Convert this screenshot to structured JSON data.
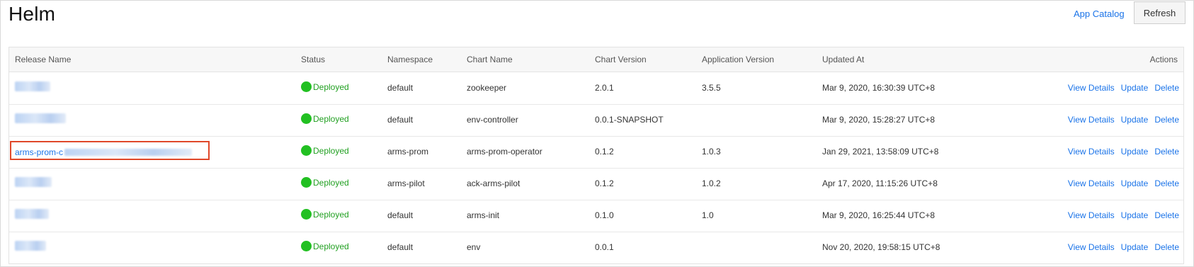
{
  "page": {
    "title": "Helm"
  },
  "toolbar": {
    "catalog_label": "App Catalog",
    "refresh_label": "Refresh"
  },
  "colors": {
    "link": "#1a73e8",
    "deployed": "#22c022",
    "highlight": "#e0482a"
  },
  "table": {
    "headers": {
      "release_name": "Release Name",
      "status": "Status",
      "namespace": "Namespace",
      "chart_name": "Chart Name",
      "chart_version": "Chart Version",
      "app_version": "Application Version",
      "updated_at": "Updated At",
      "actions": "Actions"
    },
    "action_labels": {
      "view": "View Details",
      "update": "Update",
      "delete": "Delete"
    },
    "rows": [
      {
        "name_visible": "",
        "status": "Deployed",
        "namespace": "default",
        "chart": "zookeeper",
        "chart_version": "2.0.1",
        "app_version": "3.5.5",
        "updated": "Mar 9, 2020, 16:30:39 UTC+8"
      },
      {
        "name_visible": "",
        "status": "Deployed",
        "namespace": "default",
        "chart": "env-controller",
        "chart_version": "0.0.1-SNAPSHOT",
        "app_version": "",
        "updated": "Mar 9, 2020, 15:28:27 UTC+8"
      },
      {
        "name_visible": "arms-prom-c",
        "status": "Deployed",
        "namespace": "arms-prom",
        "chart": "arms-prom-operator",
        "chart_version": "0.1.2",
        "app_version": "1.0.3",
        "updated": "Jan 29, 2021, 13:58:09 UTC+8"
      },
      {
        "name_visible": "",
        "status": "Deployed",
        "namespace": "arms-pilot",
        "chart": "ack-arms-pilot",
        "chart_version": "0.1.2",
        "app_version": "1.0.2",
        "updated": "Apr 17, 2020, 11:15:26 UTC+8"
      },
      {
        "name_visible": "",
        "status": "Deployed",
        "namespace": "default",
        "chart": "arms-init",
        "chart_version": "0.1.0",
        "app_version": "1.0",
        "updated": "Mar 9, 2020, 16:25:44 UTC+8"
      },
      {
        "name_visible": "",
        "status": "Deployed",
        "namespace": "default",
        "chart": "env",
        "chart_version": "0.0.1",
        "app_version": "",
        "updated": "Nov 20, 2020, 19:58:15 UTC+8"
      }
    ]
  }
}
